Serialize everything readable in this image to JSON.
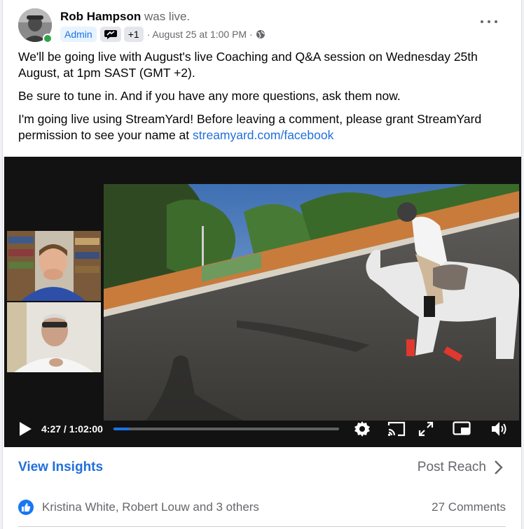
{
  "post": {
    "author": "Rob Hampson",
    "status_text": "was live.",
    "admin_badge": "Admin",
    "plus_badge": "+1",
    "time_text": "· August 25 at 1:00 PM ·",
    "paragraphs": [
      "We'll be going live with August's live Coaching and Q&A session on Wednesday 25th August, at 1pm SAST (GMT +2).",
      "Be sure to tune in. And if you have any more questions, ask them now."
    ],
    "streamyard_text": "I'm going live using StreamYard! Before leaving a comment, please grant StreamYard permission to see your name at ",
    "streamyard_link": "streamyard.com/facebook"
  },
  "video": {
    "current_time": "4:27",
    "duration": "1:02:00",
    "progress_fraction": 0.072
  },
  "footer": {
    "view_insights": "View Insights",
    "post_reach": "Post Reach",
    "reactors": "Kristina White, Robert Louw and 3 others",
    "comments": "27 Comments"
  },
  "icons": {
    "more": "more-options-icon",
    "globe": "globe-icon",
    "badge": "speech-bubble-badge-icon",
    "play": "play-icon",
    "settings": "gear-icon",
    "cast": "cast-icon",
    "fullscreen": "expand-icon",
    "pip": "picture-in-picture-icon",
    "volume": "volume-icon",
    "like": "like-icon",
    "chevron": "chevron-right-icon"
  },
  "colors": {
    "link": "#216fdb",
    "secondary_text": "#65676b",
    "online": "#31a24c",
    "like": "#1877f2"
  }
}
